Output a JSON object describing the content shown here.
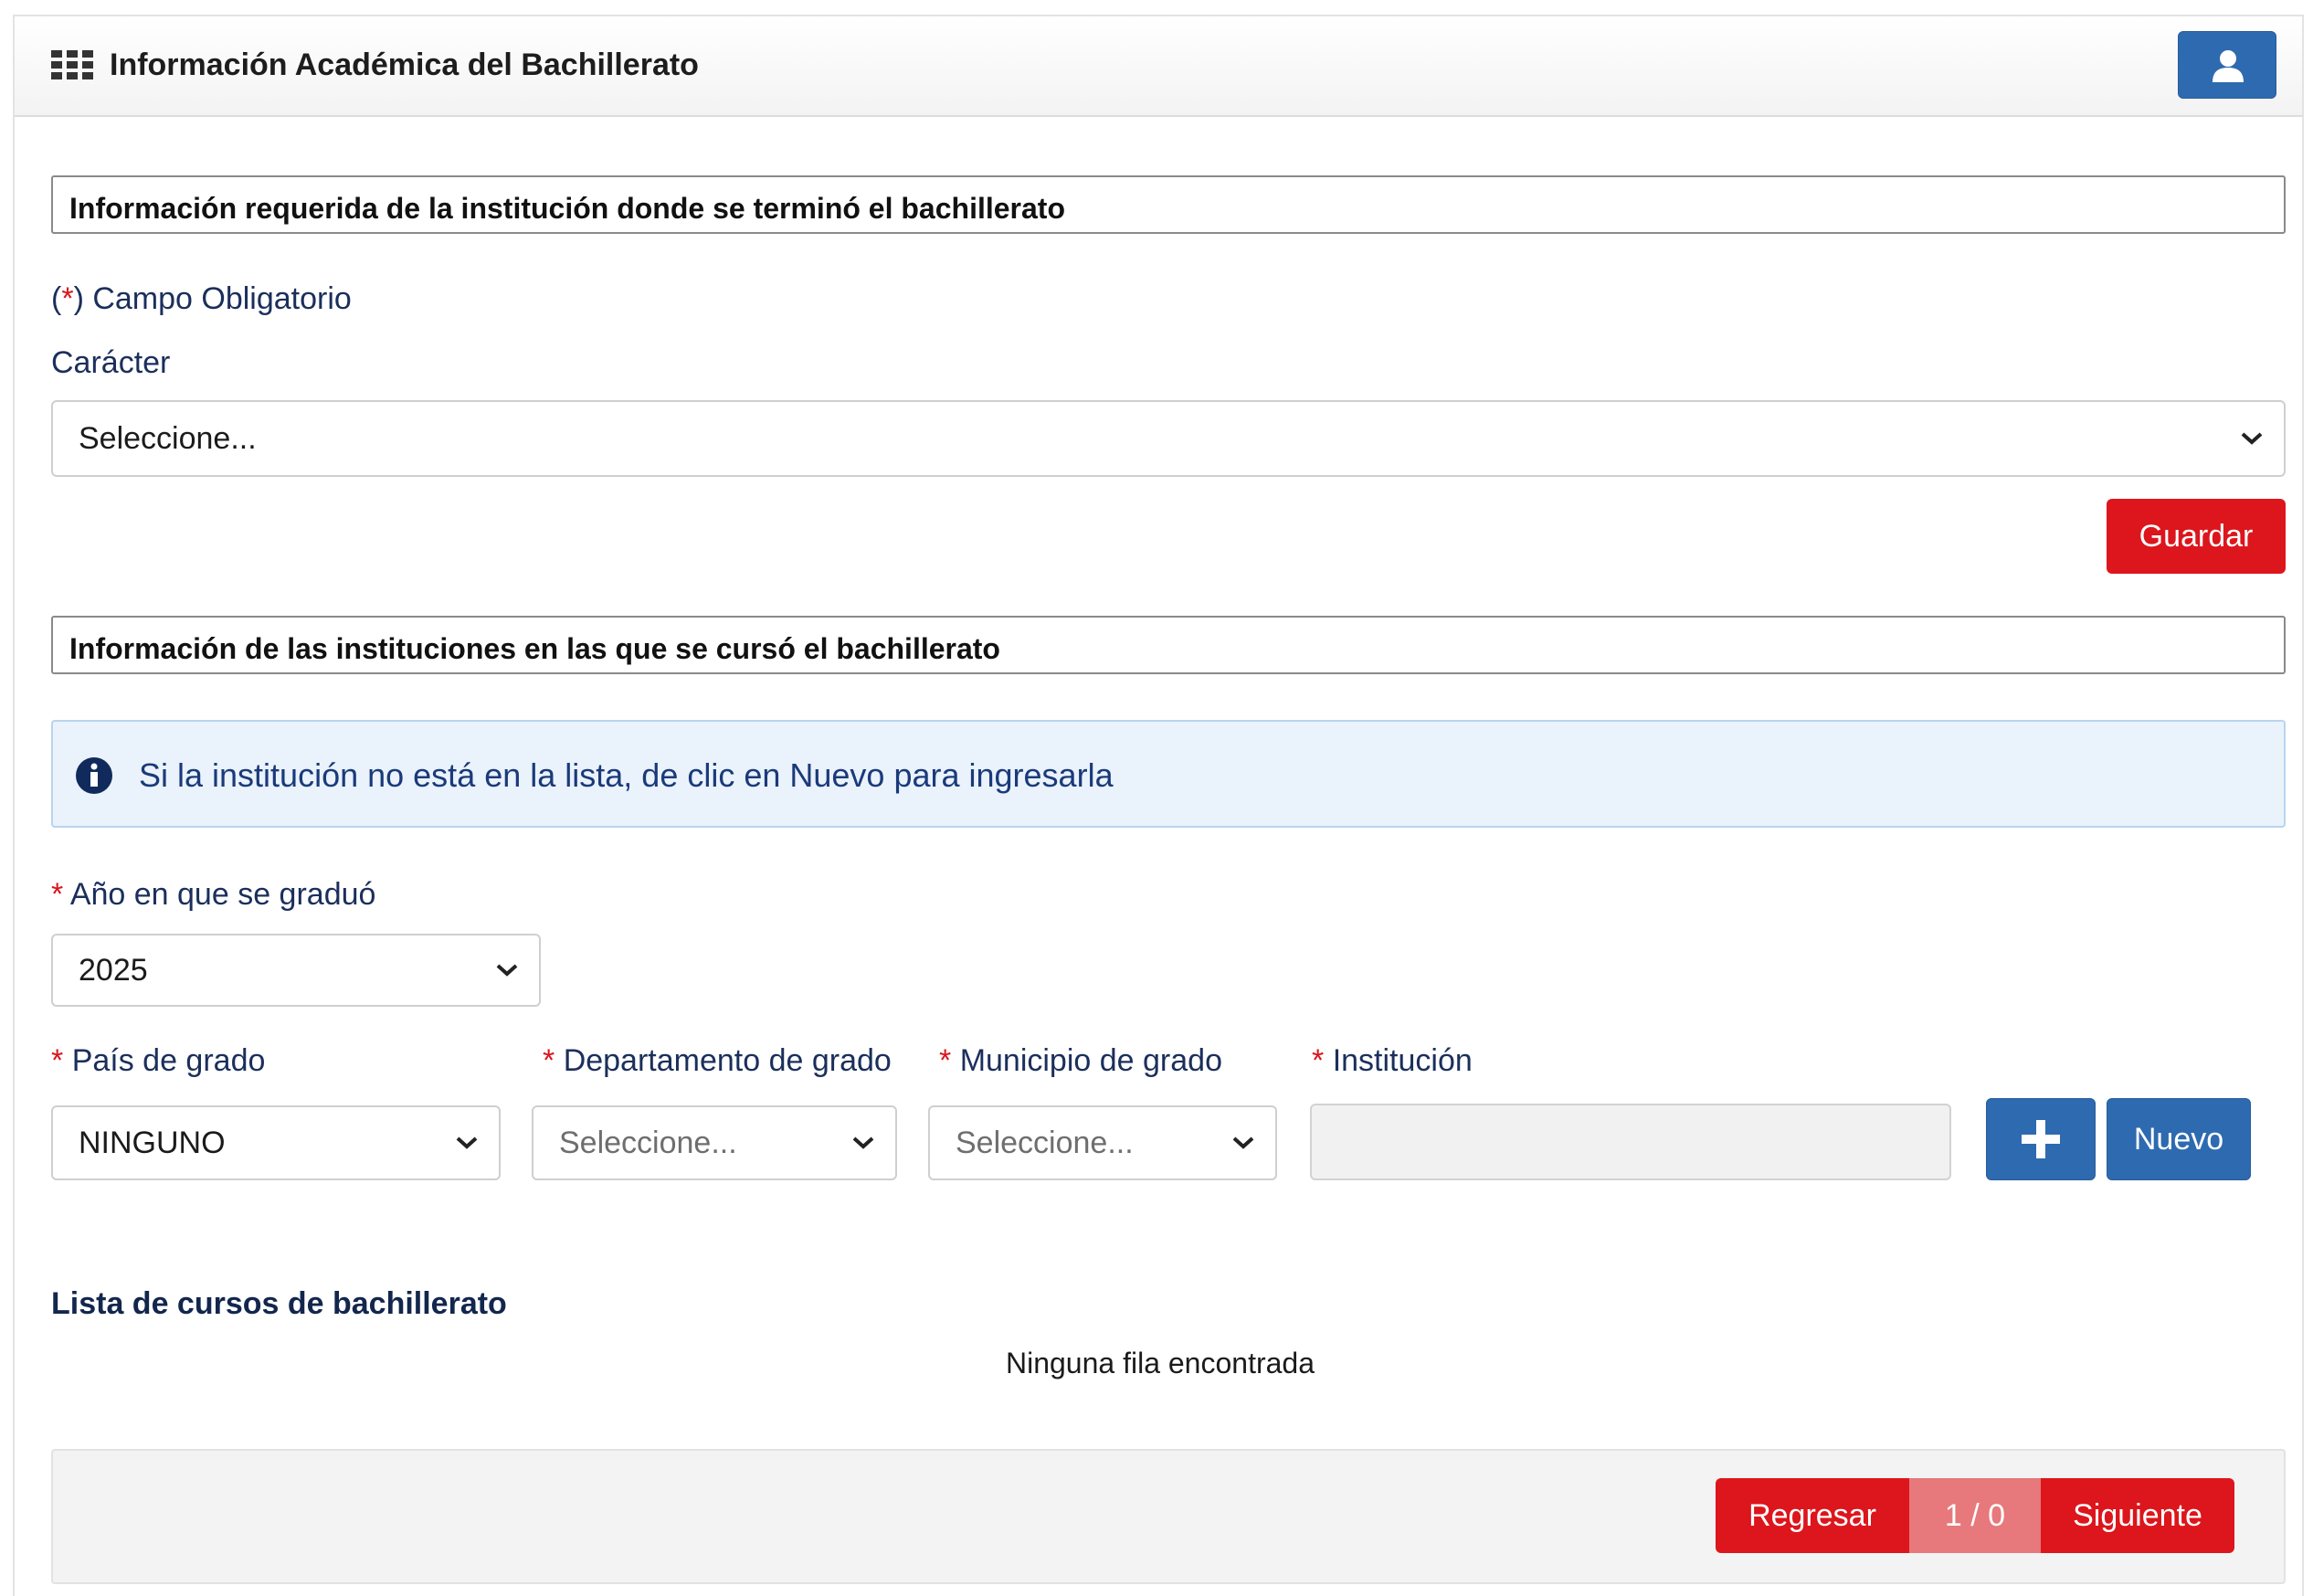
{
  "header": {
    "title": "Información Académica del Bachillerato",
    "user_icon": "user-icon",
    "menu_icon": "grid-icon"
  },
  "section1": {
    "title": "Información requerida de la institución donde se terminó el bachillerato",
    "required_note_open": "(",
    "required_note_star": "*",
    "required_note_close": ") Campo Obligatorio",
    "caracter_label": "Carácter",
    "caracter_value": "Seleccione...",
    "save_label": "Guardar"
  },
  "section2": {
    "title": "Información de las instituciones en las que se cursó el bachillerato",
    "info_text": "Si la institución no está en la lista, de clic en Nuevo para ingresarla",
    "required_star": "*",
    "year_label": "Año en que se graduó",
    "year_value": "2025",
    "country_label": "País de grado",
    "country_value": "NINGUNO",
    "department_label": "Departamento de grado",
    "department_value": "Seleccione...",
    "municipality_label": "Municipio de grado",
    "municipality_value": "Seleccione...",
    "institution_label": "Institución",
    "institution_value": "",
    "new_label": "Nuevo"
  },
  "list": {
    "title": "Lista de cursos de bachillerato",
    "empty_message": "Ninguna fila encontrada"
  },
  "pager": {
    "back_label": "Regresar",
    "count": "1 / 0",
    "next_label": "Siguiente"
  },
  "colors": {
    "primary_blue": "#2e6ab0",
    "danger_red": "#dc161c",
    "info_bg": "#eaf2fb"
  }
}
